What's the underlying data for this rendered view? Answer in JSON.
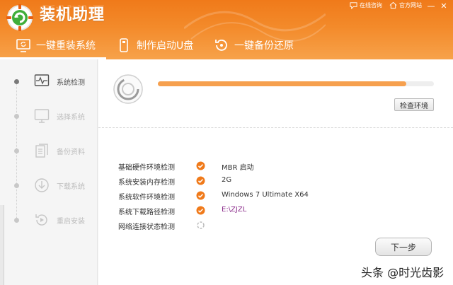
{
  "app": {
    "title": "装机助理"
  },
  "top_links": [
    {
      "label": "在线咨询",
      "icon": "chat-icon"
    },
    {
      "label": "官方网站",
      "icon": "home-icon"
    }
  ],
  "window": {
    "minimize": "—",
    "close": "✕"
  },
  "nav": {
    "tabs": [
      {
        "label": "一键重装系统",
        "icon": "reinstall-icon",
        "active": true
      },
      {
        "label": "制作启动U盘",
        "icon": "usb-icon",
        "active": false
      },
      {
        "label": "一键备份还原",
        "icon": "restore-icon",
        "active": false
      }
    ]
  },
  "sidebar": {
    "items": [
      {
        "label": "系统检测",
        "icon": "pulse-monitor-icon",
        "active": true
      },
      {
        "label": "选择系统",
        "icon": "monitor-icon",
        "active": false
      },
      {
        "label": "备份资料",
        "icon": "documents-icon",
        "active": false
      },
      {
        "label": "下载系统",
        "icon": "download-icon",
        "active": false
      },
      {
        "label": "重启安装",
        "icon": "restart-icon",
        "active": false
      }
    ]
  },
  "main": {
    "progress": 0.9,
    "check_button": "检查环境",
    "checks": [
      {
        "label": "基础硬件环境检测",
        "status": "ok",
        "value": "MBR 启动",
        "link": false
      },
      {
        "label": "系统安装内存检测",
        "status": "ok",
        "value": "2G",
        "link": false
      },
      {
        "label": "系统软件环境检测",
        "status": "ok",
        "value": "Windows 7 Ultimate X64",
        "link": false
      },
      {
        "label": "系统下载路径检测",
        "status": "ok",
        "value": "E:\\ZJZL",
        "link": true
      },
      {
        "label": "网络连接状态检测",
        "status": "loading",
        "value": "",
        "link": false
      }
    ],
    "next_button": "下一步"
  },
  "watermark": {
    "text": "头条 @时光齿影"
  },
  "colors": {
    "accent": "#f07a1a",
    "progress": "#f6a04e",
    "check_ok": "#f07a1a",
    "link": "#8a2b8a"
  }
}
